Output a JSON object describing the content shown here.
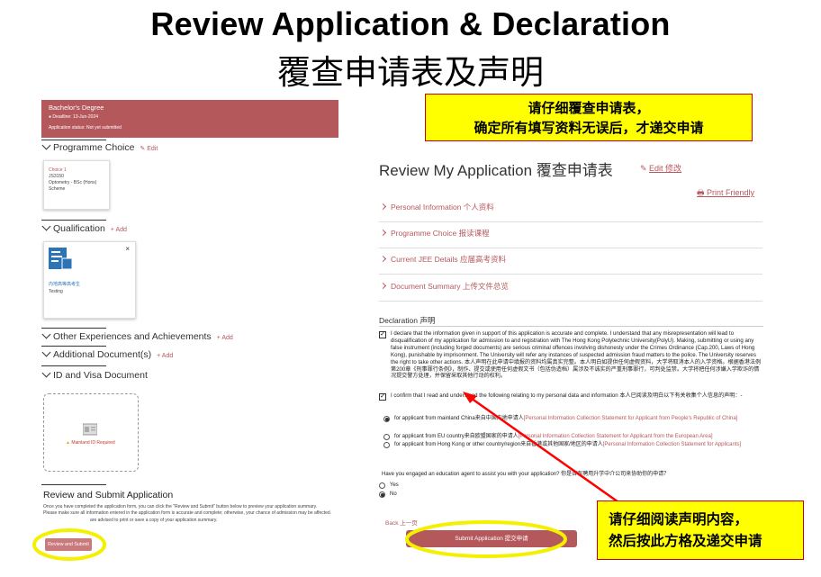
{
  "header": {
    "title_en": "Review Application & Declaration",
    "title_zh": "覆查申请表及声明"
  },
  "left_panel": {
    "degree_card": {
      "title": "Bachelor's Degree",
      "deadline": "Deadline: 13-Jun-2024",
      "status": "Application status: Not yet submitted"
    },
    "programme_choice": {
      "label": "Programme Choice",
      "edit_label": "Edit",
      "choice": {
        "index": "Choice 1",
        "code": "JS3150",
        "name": "Optometry - BSc (Hons)",
        "type": "Scheme"
      }
    },
    "qualification": {
      "label": "Qualification",
      "add_label": "Add",
      "card_line1": "内地高等高考生",
      "card_line2": "Testing",
      "close": "×"
    },
    "other_experiences": {
      "label": "Other Experiences and Achievements",
      "add_label": "Add"
    },
    "additional_documents": {
      "label": "Additional Document(s)",
      "add_label": "Add"
    },
    "id_visa": {
      "label": "ID and Visa Document",
      "doc_label": "Mainland ID Required"
    },
    "review_submit": {
      "heading": "Review and Submit Application",
      "desc_1": "Once you have completed the application form, you can click the \"Review and Submit\" button below to preview your application summary.",
      "desc_2": "Please make sure all information entered in the application form is accurate and complete; otherwise, your chance of admission may be affected.",
      "desc_3": "are advised to print or save a copy of your application summary.",
      "button_label": "Review and Submit"
    }
  },
  "callouts": {
    "top_line1": "请仔细覆查申请表，",
    "top_line2": "确定所有填写资料无误后，才递交申请",
    "bottom_line1": "请仔细阅读声明内容，",
    "bottom_line2": "然后按此方格及递交申请"
  },
  "review": {
    "title": "Review My Application 覆查申请表",
    "edit_label": "Edit 修改",
    "print_label": "Print Friendly",
    "sections": [
      "Personal Information 个人资料",
      "Programme Choice 报读课程",
      "Current JEE Details 应届高考资料",
      "Document Summary 上传文件总览"
    ],
    "declaration_heading": "Declaration 声明",
    "declaration_1": "I declare that the information given in support of this application is accurate and complete. I understand that any misrepresentation will lead to disqualification of my application for admission to and registration with The Hong Kong Polytechnic University(PolyU). Making, submitting or using any false instrument (including forged documents) are serious criminal offences involving dishonesty under the Crimes Ordinance (Cap.200, Laws of Hong Kong), punishable by imprisonment. The University will refer any instances of suspected admission fraud matters to the police. The University reserves the right to take other actions. 本人声明在此申请中填报的资料均属真实完整。本人明白如提供任何虚假资料，大学将取消本人的入学资格。根据香港法例第200章《刑事罪行条例》，制作、提交或使用任何虚假文书（包括伪造档）属涉及不诚实的严重刑事罪行，可判处监禁。大学将把任何涉嫌入学欺诈的情况提交警方处理，并保留采取其他行动的权利。",
    "declaration_2": "I confirm that I read and understood the following relating to my personal data and information 本人已阅读及明白以下有关收集个人信息的声明：-",
    "radios": [
      {
        "text": "for applicant from mainland China来自中国内地申请人",
        "link": "[Personal Information Collection Statement for Applicant from People's Republic of China]",
        "checked": true
      },
      {
        "text": "for applicant from EU country来自欧盟国家的申请人",
        "link": "[Personal Information Collection Statement for Applicant from the European Area]",
        "checked": false
      },
      {
        "text": "for applicant from Hong Kong or other country/region来自香港或其他国家/地区的申请人",
        "link": "[Personal Information Collection Statement for Applicants]",
        "checked": false
      }
    ],
    "agent_question": "Have you engaged an education agent to assist you with your application? 你是否有聘用升学中介公司来协助你的申请？",
    "agent_options": [
      {
        "label": "Yes",
        "checked": false
      },
      {
        "label": "No",
        "checked": true
      }
    ],
    "back_label": "Back 上一页",
    "submit_label": "Submit Application 提交申请",
    "check_mark": "✓"
  },
  "colors": {
    "accent": "#b5585c",
    "highlight": "#ffff00",
    "highlight_border": "#cc0000",
    "ring": "#f5f000"
  }
}
